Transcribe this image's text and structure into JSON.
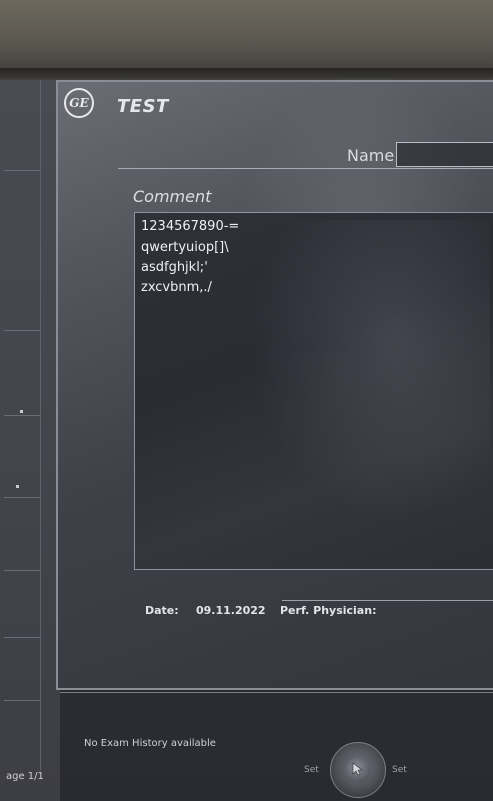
{
  "dialog": {
    "logo_text": "GE",
    "title": "TEST",
    "name_label": "Name",
    "name_value": "",
    "comment_label": "Comment",
    "comment_lines": [
      "1234567890-=",
      "qwertyuiop[]\\",
      "asdfghjkl;'",
      "zxcvbnm,./"
    ],
    "date_label": "Date:",
    "date_value": "09.11.2022",
    "physician_label": "Perf. Physician:"
  },
  "status": {
    "no_exam": "No Exam History available",
    "page": "age 1/1"
  },
  "controls": {
    "set_left": "Set",
    "set_right": "Set"
  },
  "colors": {
    "dialog_border": "#8a8c96",
    "text": "#e6e7ee"
  },
  "icons": {
    "logo": "ge-logo-icon",
    "trackball": "trackball-icon",
    "cursor": "cursor-arrow-icon"
  }
}
